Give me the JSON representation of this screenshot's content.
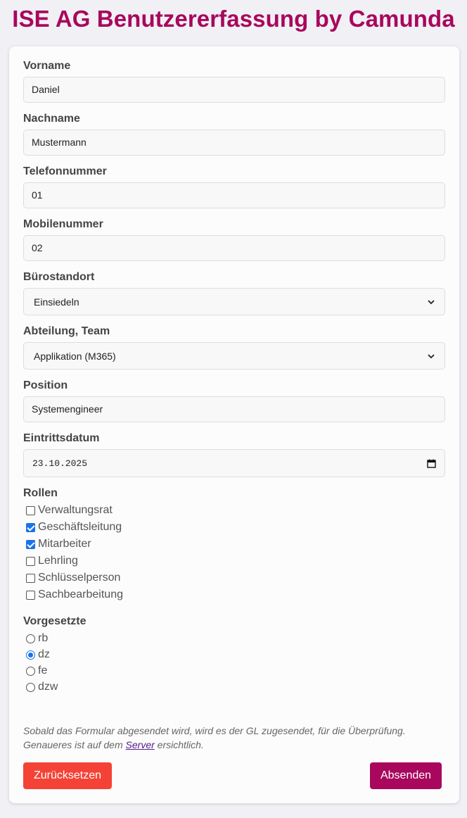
{
  "title": "ISE AG Benutzererfassung by Camunda",
  "fields": {
    "vorname": {
      "label": "Vorname",
      "value": "Daniel"
    },
    "nachname": {
      "label": "Nachname",
      "value": "Mustermann"
    },
    "telefon": {
      "label": "Telefonnummer",
      "value": "01"
    },
    "mobile": {
      "label": "Mobilenummer",
      "value": "02"
    },
    "buero": {
      "label": "Bürostandort",
      "value": "Einsiedeln"
    },
    "abteilung": {
      "label": "Abteilung, Team",
      "value": "Applikation (M365)"
    },
    "position": {
      "label": "Position",
      "value": "Systemengineer"
    },
    "eintritt": {
      "label": "Eintrittsdatum",
      "value": "23.10.2025"
    }
  },
  "roles": {
    "label": "Rollen",
    "items": [
      {
        "label": "Verwaltungsrat",
        "checked": false
      },
      {
        "label": "Geschäftsleitung",
        "checked": true
      },
      {
        "label": "Mitarbeiter",
        "checked": true
      },
      {
        "label": "Lehrling",
        "checked": false
      },
      {
        "label": "Schlüsselperson",
        "checked": false
      },
      {
        "label": "Sachbearbeitung",
        "checked": false
      }
    ]
  },
  "supervisors": {
    "label": "Vorgesetzte",
    "items": [
      {
        "label": "rb",
        "selected": false
      },
      {
        "label": "dz",
        "selected": true
      },
      {
        "label": "fe",
        "selected": false
      },
      {
        "label": "dzw",
        "selected": false
      }
    ]
  },
  "note": {
    "text1": "Sobald das Formular abgesendet wird, wird es der GL zugesendet, für die Überprüfung. Genaueres ist auf dem ",
    "link": "Server",
    "text2": " ersichtlich."
  },
  "buttons": {
    "reset": "Zurücksetzen",
    "submit": "Absenden"
  },
  "colors": {
    "accent": "#a8075d",
    "reset": "#f44336",
    "checkbox": "#1a73e8"
  }
}
